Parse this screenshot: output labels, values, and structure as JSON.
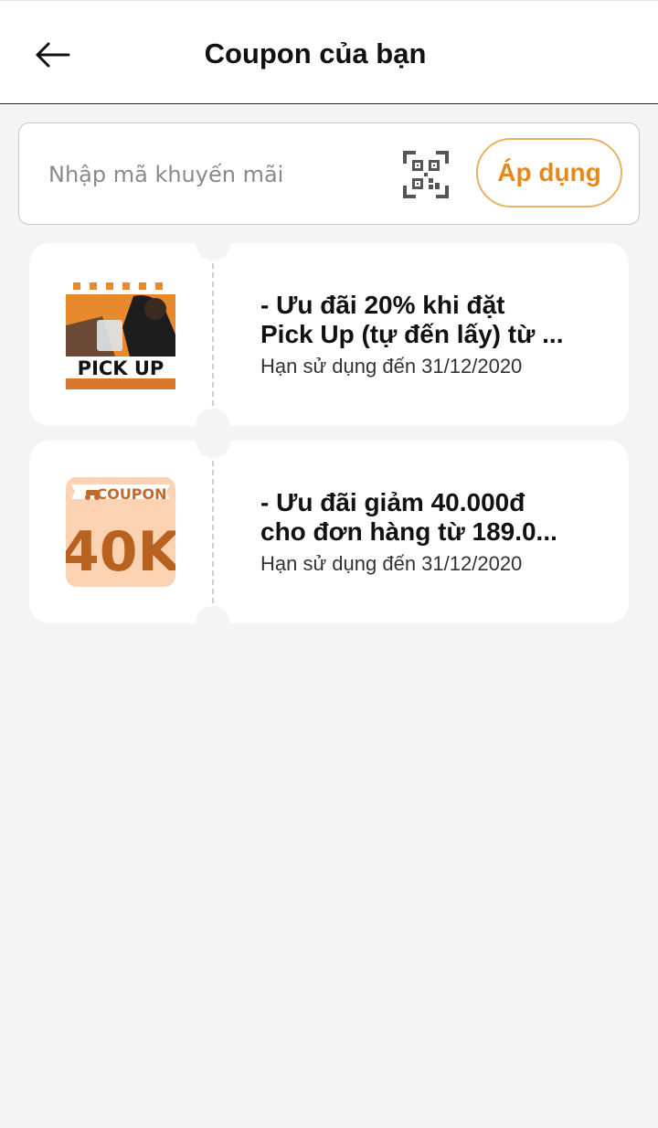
{
  "header": {
    "title": "Coupon của bạn",
    "back_icon": "arrow-left-icon"
  },
  "promo": {
    "placeholder": "Nhập mã khuyến mãi",
    "value": "",
    "qr_icon": "qr-code-icon",
    "apply_label": "Áp dụng"
  },
  "colors": {
    "accent": "#e48a1c",
    "accent_border": "#eab25e",
    "background": "#f4f4f4"
  },
  "coupons": [
    {
      "title_line1": "- Ưu đãi 20% khi đặt",
      "title_line2": "Pick Up (tự đến lấy) từ ...",
      "expiry": "Hạn sử dụng đến 31/12/2020",
      "thumb_text": "PICK UP"
    },
    {
      "title_line1": "- Ưu đãi giảm 40.000đ",
      "title_line2": "cho đơn hàng từ 189.0...",
      "expiry": "Hạn sử dụng đến 31/12/2020",
      "thumb_label": "COUPON",
      "thumb_value": "40K"
    }
  ]
}
